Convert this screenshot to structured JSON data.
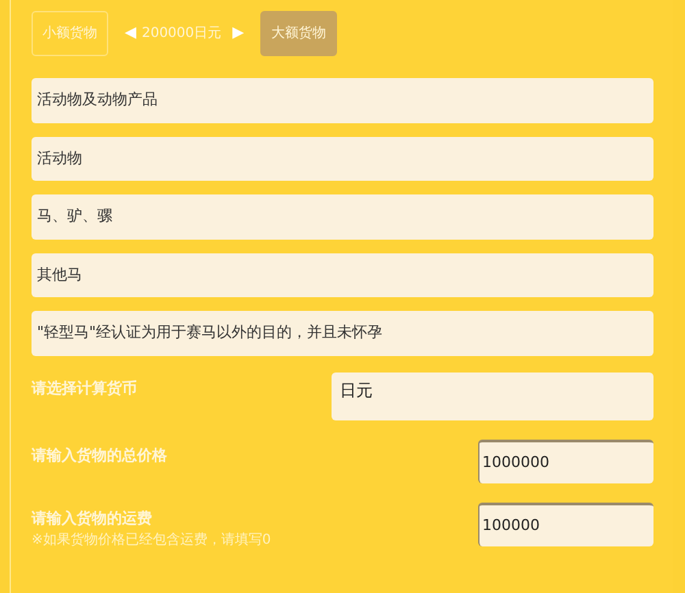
{
  "tabs": [
    {
      "label": "小额货物",
      "selected": false
    },
    {
      "label": "大额货物",
      "selected": true
    }
  ],
  "threshold": {
    "prev": "◀",
    "text": "200000日元",
    "next": "▶"
  },
  "categories": [
    "活动物及动物产品",
    "活动物",
    "马、驴、骡",
    "其他马",
    "\"轻型马\"经认证为用于赛马以外的目的，并且未怀孕"
  ],
  "fields": [
    {
      "kind": "select",
      "label": "请选择计算货币",
      "value": "日元"
    },
    {
      "kind": "input",
      "label": "请输入货物的总价格",
      "value": "1000000"
    },
    {
      "kind": "input",
      "label": "请输入货物的运费",
      "note": "※如果货物价格已经包含运费，请填写0",
      "value": "100000"
    }
  ]
}
